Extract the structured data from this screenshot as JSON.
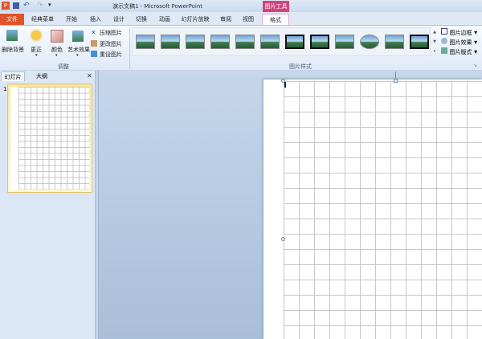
{
  "window": {
    "title": "演示文稿1 - Microsoft PowerPoint",
    "context_tool": "图片工具"
  },
  "quick_access": {
    "icons": [
      "powerpoint-logo-icon",
      "save-icon",
      "undo-icon",
      "redo-icon",
      "customize-icon"
    ]
  },
  "tabs": [
    {
      "label": "文件"
    },
    {
      "label": "经典菜单"
    },
    {
      "label": "开始"
    },
    {
      "label": "插入"
    },
    {
      "label": "设计"
    },
    {
      "label": "切换"
    },
    {
      "label": "动画"
    },
    {
      "label": "幻灯片放映"
    },
    {
      "label": "审阅"
    },
    {
      "label": "视图"
    },
    {
      "label": "格式"
    }
  ],
  "ribbon": {
    "adjust": {
      "label": "调整",
      "remove_bg": "删除背景",
      "corrections": "更正",
      "color": "颜色",
      "artistic": "艺术效果",
      "compress": "压缩图片",
      "change": "更改图片",
      "reset": "重设图片"
    },
    "styles": {
      "label": "图片样式",
      "border": "图片边框",
      "effects": "图片效果",
      "layout": "图片版式",
      "style_count": 12
    }
  },
  "pane": {
    "tabs": [
      "幻灯片",
      "大纲"
    ],
    "close": "✕",
    "slide_number": "1"
  },
  "colors": {
    "file_tab": "#e0542a",
    "context_tab": "#d0457e",
    "accent": "#e7a9c8"
  }
}
